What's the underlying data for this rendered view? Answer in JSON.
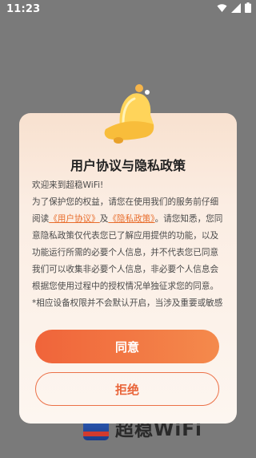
{
  "status_bar": {
    "time": "11:23",
    "icons": [
      "wifi-icon",
      "signal-icon",
      "battery-icon"
    ]
  },
  "background_app": {
    "name": "超稳WiFi",
    "logo_caption": "超稳WiFi"
  },
  "dialog": {
    "title": "用户协议与隐私政策",
    "greeting": "欢迎来到超稳WiFi!",
    "para1_prefix": "为了保护您的权益，请您在使用我们的服务前仔细阅读",
    "link_user_agreement": "《用户协议》",
    "and": "及",
    "link_privacy_policy": "《隐私政策》",
    "para1_suffix": "。请您知悉，您同意隐私政策仅代表您已了解应用提供的功能，以及功能运行所需的必要个人信息，并不代表您已同意我们可以收集非必要个人信息，非必要个人信息会根据您使用过程中的授权情况单独征求您的同意。",
    "para2": "*相应设备权限并不会默认开启，当涉及重要或敏感的",
    "agree_label": "同意",
    "refuse_label": "拒绝"
  },
  "colors": {
    "accent": "#f0643a",
    "link": "#e86d2c",
    "overlay": "#7a7a7a"
  }
}
